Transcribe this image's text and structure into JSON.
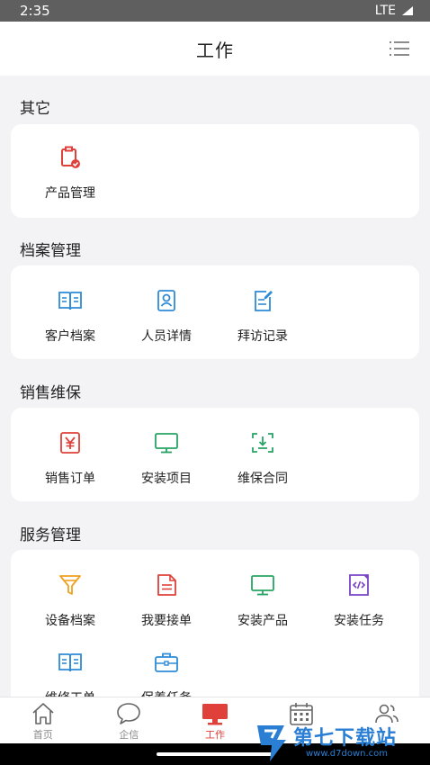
{
  "status": {
    "time": "2:35",
    "network": "LTE"
  },
  "header": {
    "title": "工作",
    "menu_icon": "list-menu-icon"
  },
  "sections": [
    {
      "title": "其它",
      "items": [
        {
          "label": "产品管理",
          "icon": "clipboard-check-icon"
        }
      ]
    },
    {
      "title": "档案管理",
      "items": [
        {
          "label": "客户档案",
          "icon": "book-icon"
        },
        {
          "label": "人员详情",
          "icon": "person-card-icon"
        },
        {
          "label": "拜访记录",
          "icon": "edit-note-icon"
        }
      ]
    },
    {
      "title": "销售维保",
      "items": [
        {
          "label": "销售订单",
          "icon": "yen-icon"
        },
        {
          "label": "安装项目",
          "icon": "monitor-icon"
        },
        {
          "label": "维保合同",
          "icon": "scan-download-icon"
        }
      ]
    },
    {
      "title": "服务管理",
      "items": [
        {
          "label": "设备档案",
          "icon": "funnel-icon"
        },
        {
          "label": "我要接单",
          "icon": "document-icon"
        },
        {
          "label": "安装产品",
          "icon": "monitor-icon"
        },
        {
          "label": "安装任务",
          "icon": "code-file-icon"
        },
        {
          "label": "维修工单",
          "icon": "book-icon"
        },
        {
          "label": "保养任务",
          "icon": "briefcase-icon"
        }
      ]
    }
  ],
  "tabs": [
    {
      "label": "首页",
      "icon": "home-icon",
      "active": false
    },
    {
      "label": "企信",
      "icon": "chat-icon",
      "active": false
    },
    {
      "label": "工作",
      "icon": "monitor-icon",
      "active": true
    },
    {
      "label": "",
      "icon": "calendar-icon",
      "active": false
    },
    {
      "label": "",
      "icon": "contacts-icon",
      "active": false
    }
  ],
  "watermark": {
    "text": "第七下载站",
    "url": "www.d7down.com"
  },
  "colors": {
    "accent": "#e0403a",
    "blue": "#2e8bd6",
    "green": "#27a464",
    "orange": "#f0a020",
    "purple": "#7a44c6"
  }
}
